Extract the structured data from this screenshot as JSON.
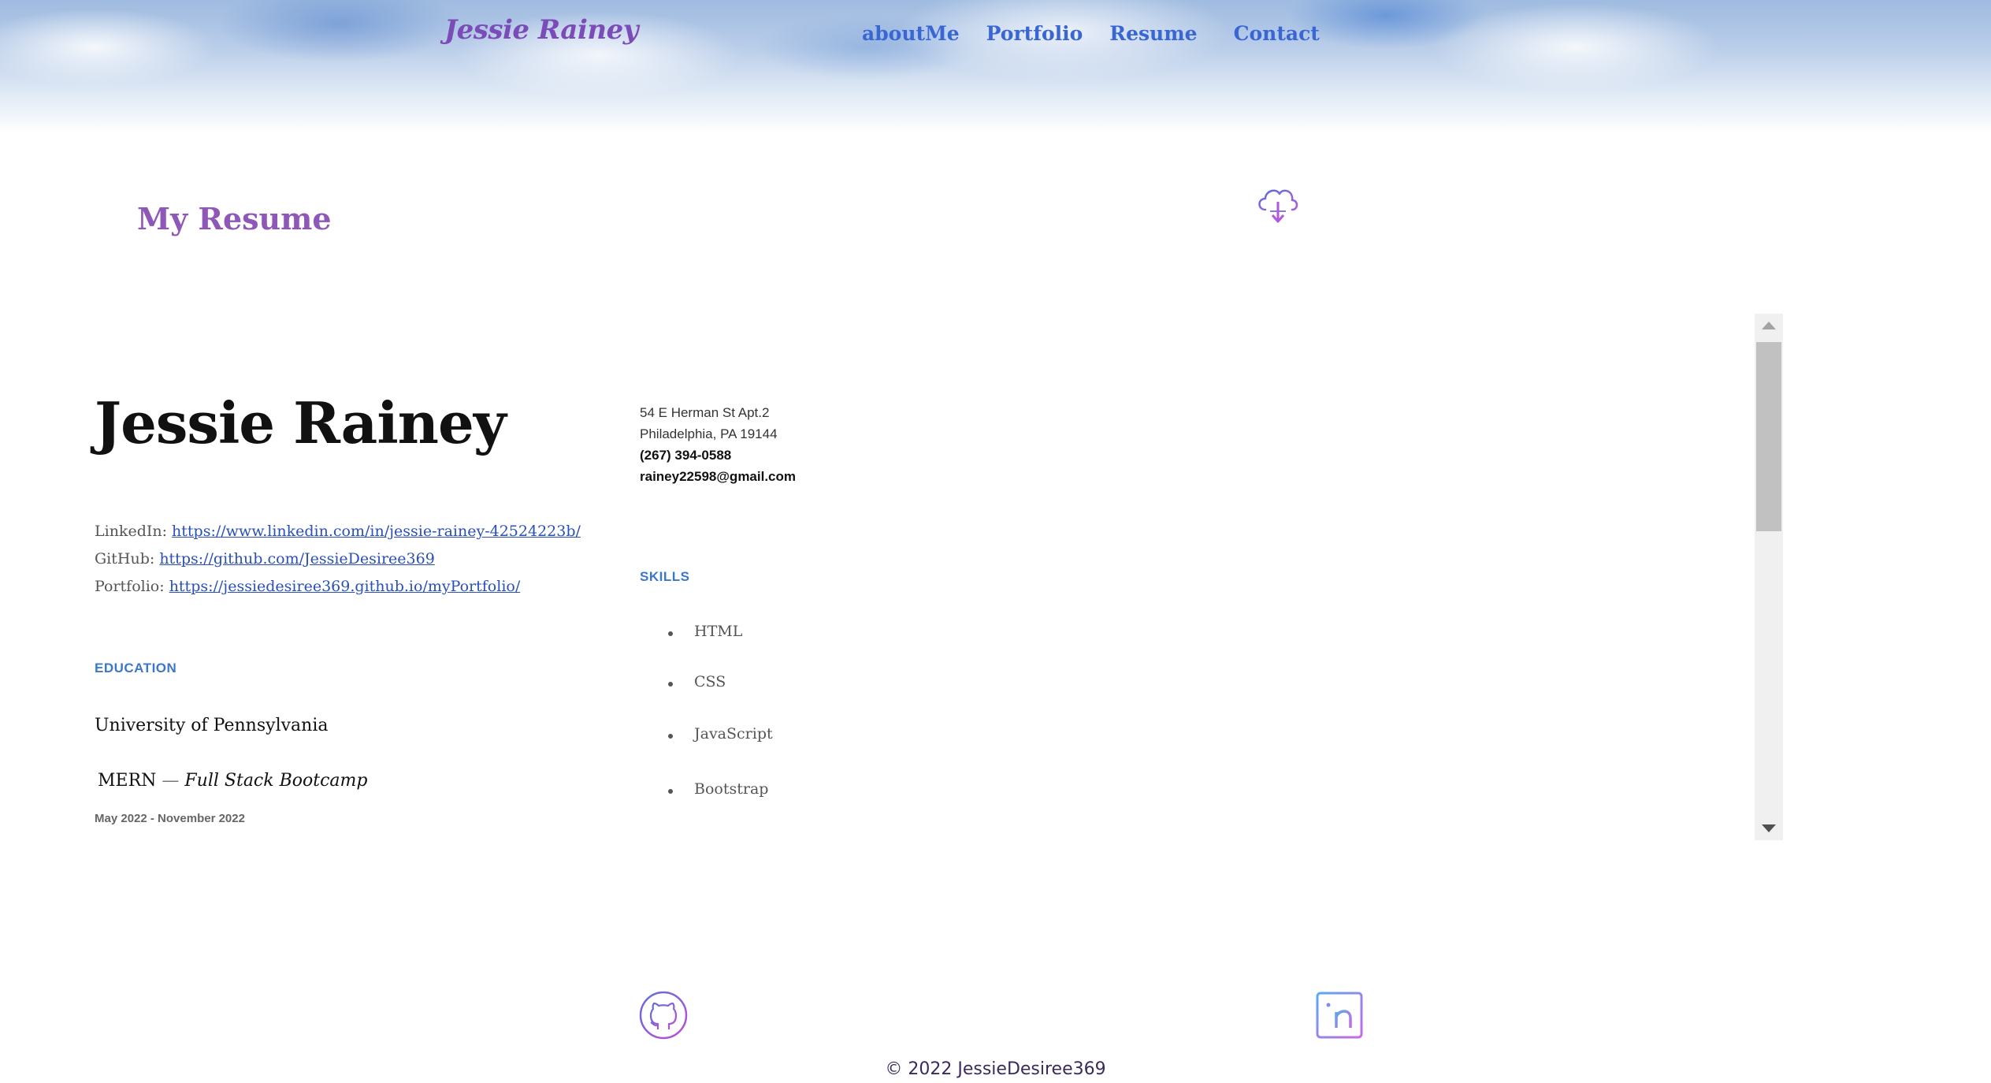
{
  "header": {
    "brand": "Jessie Rainey",
    "nav": [
      "aboutMe",
      "Portfolio",
      "Resume",
      "Contact"
    ]
  },
  "main": {
    "heading": "My Resume",
    "download_icon": "cloud-download-icon"
  },
  "resume": {
    "name": "Jessie Rainey",
    "links": [
      {
        "label": "LinkedIn:",
        "url": "https://www.linkedin.com/in/jessie-rainey-42524223b/"
      },
      {
        "label": "GitHub:",
        "url": "https://github.com/JessieDesiree369"
      },
      {
        "label": "Portfolio:",
        "url": "https://jessiedesiree369.github.io/myPortfolio/"
      }
    ],
    "contact": {
      "address_line1": "54 E Herman St Apt.2",
      "address_line2": "Philadelphia, PA 19144",
      "phone": "(267) 394-0588",
      "email": "rainey22598@gmail.com"
    },
    "education": {
      "label": "EDUCATION",
      "school": "University of Pennsylvania",
      "program_prefix": "MERN",
      "program_separator": "—",
      "program_name": "Full Stack Bootcamp",
      "dates": "May 2022 - November 2022"
    },
    "skills": {
      "label": "SKILLS",
      "items": [
        "HTML",
        "CSS",
        "JavaScript",
        "Bootstrap"
      ]
    }
  },
  "footer": {
    "icons": [
      "github-icon",
      "linkedin-icon"
    ],
    "copyright": "© 2022 JessieDesiree369"
  },
  "colors": {
    "brand": "#7b4bb8",
    "nav_link": "#3a66d4",
    "heading": "#8e57b8",
    "section_label": "#3c78c8",
    "link": "#2a4fb5"
  }
}
